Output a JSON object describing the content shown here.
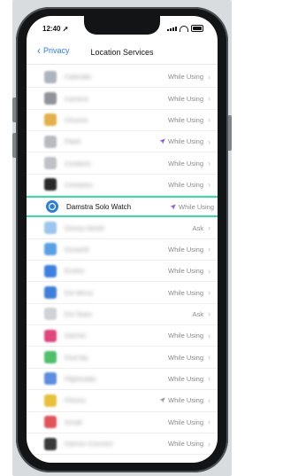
{
  "status_bar": {
    "time": "12:40"
  },
  "nav": {
    "back_label": "Privacy",
    "title": "Location Services"
  },
  "rows": [
    {
      "name": "Calendar",
      "permission": "While Using",
      "icon_color": "#aeb4bf",
      "arrow": ""
    },
    {
      "name": "Camera",
      "permission": "While Using",
      "icon_color": "#8f949b",
      "arrow": ""
    },
    {
      "name": "Chrome",
      "permission": "While Using",
      "icon_color": "#e4b04a",
      "arrow": ""
    },
    {
      "name": "Flash",
      "permission": "While Using",
      "icon_color": "#b8bcc2",
      "arrow": "purple"
    },
    {
      "name": "Contacts",
      "permission": "While Using",
      "icon_color": "#bfc2c6",
      "arrow": ""
    },
    {
      "name": "Compass",
      "permission": "While Using",
      "icon_color": "#2b2b2b",
      "arrow": ""
    },
    {
      "name": "Damstra Solo Watch",
      "permission": "While Using",
      "icon_color": "#2f7fd8",
      "arrow": "purple",
      "highlighted": true
    },
    {
      "name": "Disney World",
      "permission": "Ask",
      "icon_color": "#9cc6ee",
      "arrow": ""
    },
    {
      "name": "Duracell",
      "permission": "While Using",
      "icon_color": "#5aa0e6",
      "arrow": ""
    },
    {
      "name": "Evolve",
      "permission": "While Using",
      "icon_color": "#3d80e0",
      "arrow": ""
    },
    {
      "name": "Ext Mirror",
      "permission": "While Using",
      "icon_color": "#3f7fd9",
      "arrow": ""
    },
    {
      "name": "Ext Team",
      "permission": "Ask",
      "icon_color": "#cfd2d6",
      "arrow": ""
    },
    {
      "name": "Garmin",
      "permission": "While Using",
      "icon_color": "#e0467c",
      "arrow": ""
    },
    {
      "name": "Find My",
      "permission": "While Using",
      "icon_color": "#4fbf6b",
      "arrow": ""
    },
    {
      "name": "Flightradar",
      "permission": "While Using",
      "icon_color": "#5d8de0",
      "arrow": ""
    },
    {
      "name": "Fitness",
      "permission": "While Using",
      "icon_color": "#e8c03a",
      "arrow": "gray"
    },
    {
      "name": "Gmail",
      "permission": "While Using",
      "icon_color": "#e0555a",
      "arrow": ""
    },
    {
      "name": "Garmin Connect",
      "permission": "While Using",
      "icon_color": "#3a3a3a",
      "arrow": ""
    }
  ],
  "colors": {
    "accent": "#2e7cf6",
    "highlight_border": "#3cd8a6",
    "location_arrow_purple": "#8f57e8",
    "location_arrow_gray": "#9a9a9e"
  }
}
